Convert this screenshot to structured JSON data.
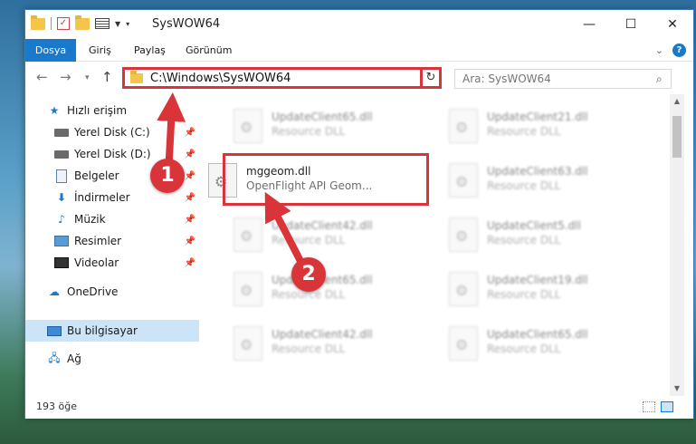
{
  "window": {
    "title": "SysWOW64"
  },
  "ribbon": {
    "tabs": [
      "Dosya",
      "Giriş",
      "Paylaş",
      "Görünüm"
    ],
    "help": "?"
  },
  "address": {
    "path": "C:\\Windows\\SysWOW64"
  },
  "search": {
    "placeholder": "Ara: SysWOW64"
  },
  "sidebar": {
    "items": [
      {
        "label": "Hızlı erişim"
      },
      {
        "label": "Yerel Disk (C:)"
      },
      {
        "label": "Yerel Disk (D:)"
      },
      {
        "label": "Belgeler"
      },
      {
        "label": "İndirmeler"
      },
      {
        "label": "Müzik"
      },
      {
        "label": "Resimler"
      },
      {
        "label": "Videolar"
      },
      {
        "label": "OneDrive"
      },
      {
        "label": "Bu bilgisayar"
      },
      {
        "label": "Ağ"
      }
    ]
  },
  "files": [
    {
      "name": "UpdateClient65.dll",
      "desc": "Resource DLL"
    },
    {
      "name": "UpdateClient21.dll",
      "desc": "Resource DLL"
    },
    {
      "name": "mggeom.dll",
      "desc": "OpenFlight API Geom..."
    },
    {
      "name": "UpdateClient63.dll",
      "desc": "Resource DLL"
    },
    {
      "name": "UpdateClient42.dll",
      "desc": "Resource DLL"
    },
    {
      "name": "UpdateClient5.dll",
      "desc": "Resource DLL"
    },
    {
      "name": "UpdateClient65.dll",
      "desc": "Resource DLL"
    },
    {
      "name": "UpdateClient19.dll",
      "desc": "Resource DLL"
    },
    {
      "name": "UpdateClient42.dll",
      "desc": "Resource DLL"
    },
    {
      "name": "UpdateClient65.dll",
      "desc": "Resource DLL"
    }
  ],
  "status": {
    "count": "193 öğe"
  },
  "badges": {
    "one": "1",
    "two": "2"
  },
  "colors": {
    "accent": "#1979ca",
    "highlight": "#d9343a"
  }
}
